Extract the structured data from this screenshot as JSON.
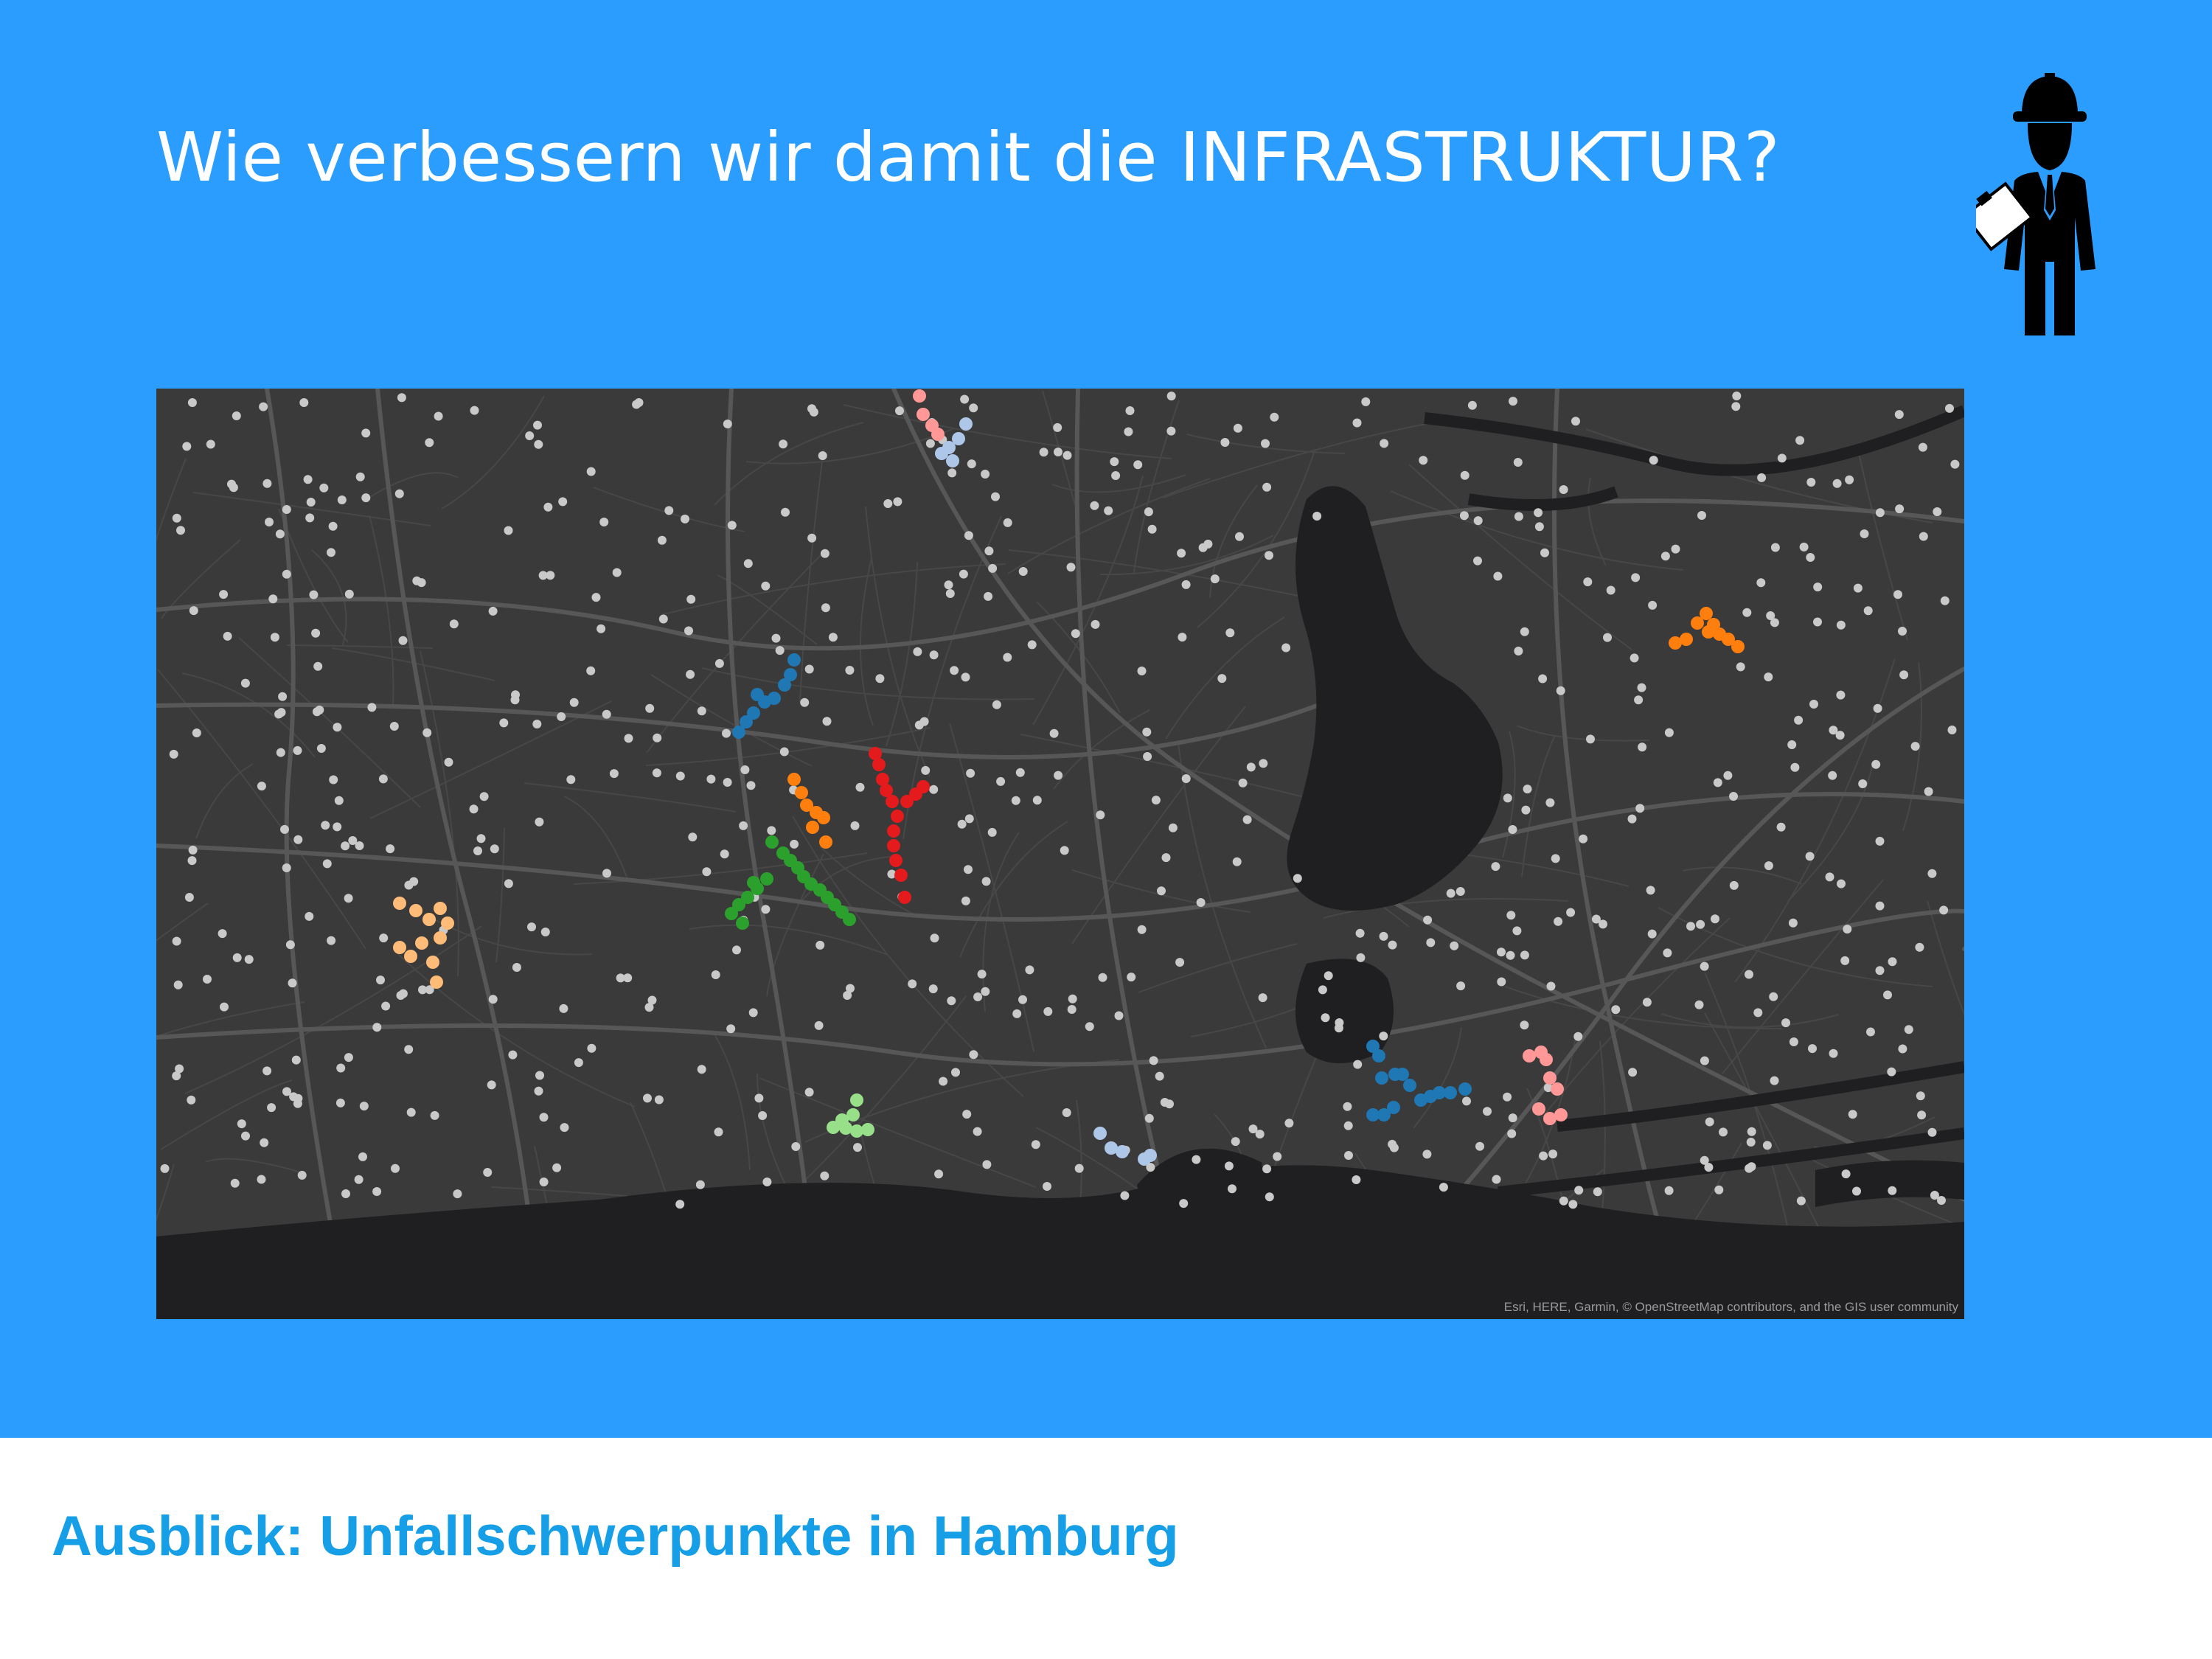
{
  "slide": {
    "headline": "Wie verbessern wir damit die INFRASTRUKTUR?",
    "footer_title": "Ausblick: Unfallschwerpunkte in Hamburg"
  },
  "icons": {
    "engineer": "engineer-with-hardhat-and-clipboard-icon"
  },
  "map": {
    "attribution": "Esri, HERE, Garmin, © OpenStreetMap contributors, and the GIS user community",
    "basemap_style": "dark gray canvas",
    "colors": {
      "background": "#3a3a3a",
      "water": "#1f1f22",
      "roads": "#4d4d4d",
      "major_roads": "#5a5a5a",
      "accident_points": "#c9c9c9"
    },
    "hotspot_colors": {
      "dark_blue": "#1f77b4",
      "orange": "#ff7f0e",
      "red": "#e41a1c",
      "green": "#2ca02c",
      "light_orange": "#ffbb78",
      "light_green": "#98df8a",
      "light_blue": "#aec7e8",
      "pink": "#ff9896"
    }
  }
}
